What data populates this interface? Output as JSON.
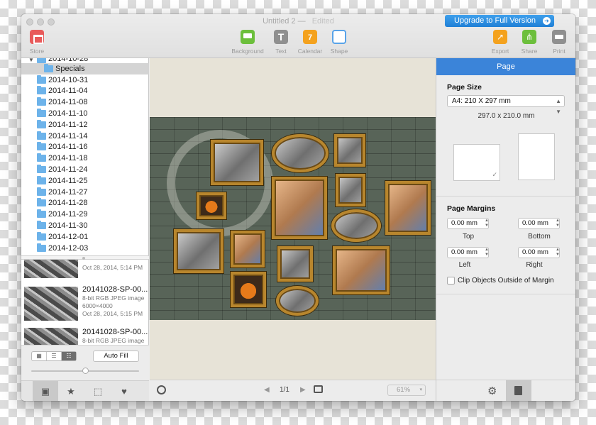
{
  "window": {
    "title": "Untitled 2",
    "title_separator": "—",
    "edited_label": "Edited",
    "upgrade_button": "Upgrade to Full Version"
  },
  "toolbar": {
    "store": "Store",
    "background": "Background",
    "text": "Text",
    "text_glyph": "T",
    "calendar": "Calendar",
    "calendar_glyph": "7",
    "shape": "Shape",
    "export": "Export",
    "share": "Share",
    "print": "Print"
  },
  "sidebar": {
    "open_folder": "2014-10-28",
    "selected_folder": "Specials",
    "folders": [
      "2014-10-31",
      "2014-11-04",
      "2014-11-08",
      "2014-11-10",
      "2014-11-12",
      "2014-11-14",
      "2014-11-16",
      "2014-11-18",
      "2014-11-24",
      "2014-11-25",
      "2014-11-27",
      "2014-11-28",
      "2014-11-29",
      "2014-11-30",
      "2014-12-01",
      "2014-12-03"
    ],
    "photos": [
      {
        "name": "",
        "type": "",
        "size": "",
        "date": "Oct 28, 2014, 5:14 PM"
      },
      {
        "name": "20141028-SP-00...",
        "type": "8-bit RGB JPEG image",
        "size": "6000×4000",
        "date": "Oct 28, 2014, 5:15 PM"
      },
      {
        "name": "20141028-SP-00...",
        "type": "8-bit RGB JPEG image",
        "size": "",
        "date": ""
      }
    ],
    "auto_fill": "Auto Fill",
    "thumbnail_size_fraction": 0.5
  },
  "canvas": {
    "page_indicator": "1/1",
    "zoom": "61%"
  },
  "inspector": {
    "header": "Page",
    "page_size_title": "Page Size",
    "page_size_value": "A4: 210 X 297 mm",
    "page_dimensions": "297.0 x 210.0 mm",
    "page_margins_title": "Page Margins",
    "margins": {
      "top": {
        "label": "Top",
        "value": "0.00 mm"
      },
      "bottom": {
        "label": "Bottom",
        "value": "0.00 mm"
      },
      "left": {
        "label": "Left",
        "value": "0.00 mm"
      },
      "right": {
        "label": "Right",
        "value": "0.00 mm"
      }
    },
    "clip_label": "Clip Objects Outside of Margin",
    "clip_checked": false
  },
  "icons": {
    "store": "store-icon",
    "background": "background-icon",
    "text": "text-icon",
    "calendar": "calendar-icon",
    "shape": "shape-icon",
    "export": "export-icon",
    "share": "share-icon",
    "print": "print-icon"
  },
  "colors": {
    "accent_blue": "#3b84d9",
    "upgrade_blue": "#1f7fd6",
    "folder_blue": "#6db3ea"
  }
}
